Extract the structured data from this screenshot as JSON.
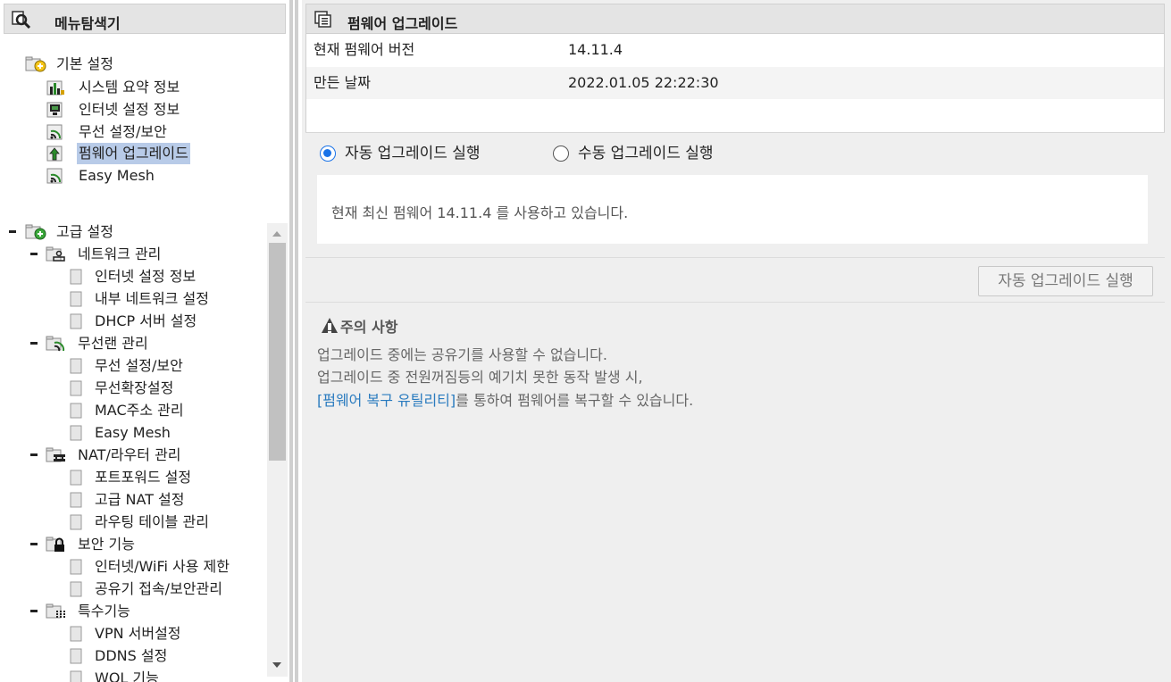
{
  "left_panel": {
    "title": "메뉴탐색기",
    "basic": {
      "label": "기본 설정",
      "items": [
        {
          "label": "시스템 요약 정보",
          "icon": "chart-icon"
        },
        {
          "label": "인터넷 설정 정보",
          "icon": "monitor-icon"
        },
        {
          "label": "무선 설정/보안",
          "icon": "wireless-icon"
        },
        {
          "label": "펌웨어 업그레이드",
          "icon": "upgrade-icon",
          "selected": true
        },
        {
          "label": "Easy Mesh",
          "icon": "wireless-icon"
        }
      ]
    },
    "advanced": {
      "label": "고급 설정",
      "groups": [
        {
          "label": "네트워크 관리",
          "icon": "network-icon",
          "items": [
            "인터넷 설정 정보",
            "내부 네트워크 설정",
            "DHCP 서버 설정"
          ]
        },
        {
          "label": "무선랜 관리",
          "icon": "wireless-icon",
          "items": [
            "무선 설정/보안",
            "무선확장설정",
            "MAC주소 관리",
            "Easy Mesh"
          ]
        },
        {
          "label": "NAT/라우터 관리",
          "icon": "router-icon",
          "items": [
            "포트포워드 설정",
            "고급 NAT 설정",
            "라우팅 테이블 관리"
          ]
        },
        {
          "label": "보안 기능",
          "icon": "lock-icon",
          "items": [
            "인터넷/WiFi 사용 제한",
            "공유기 접속/보안관리"
          ]
        },
        {
          "label": "특수기능",
          "icon": "grid-icon",
          "items": [
            "VPN 서버설정",
            "DDNS 설정",
            "WOL 기능"
          ]
        }
      ]
    }
  },
  "right_panel": {
    "title": "펌웨어 업그레이드",
    "info": [
      {
        "key": "현재 펌웨어 버전",
        "value": "14.11.4"
      },
      {
        "key": "만든 날짜",
        "value": "2022.01.05 22:22:30"
      }
    ],
    "modes": {
      "auto": "자동 업그레이드 실행",
      "manual": "수동 업그레이드 실행",
      "selected": "auto"
    },
    "status_text": "현재 최신 펌웨어 14.11.4 를 사용하고 있습니다.",
    "run_button": "자동 업그레이드 실행",
    "notice": {
      "title": "주의 사항",
      "line1": "업그레이드 중에는 공유기를 사용할 수 없습니다.",
      "line2": "업그레이드 중 전원꺼짐등의 예기치 못한 동작 발생 시,",
      "link": "[펌웨어 복구 유틸리티]",
      "line3_rest": "를 통하여 펌웨어를 복구할 수 있습니다."
    }
  },
  "colors": {
    "selected_bg": "#b8cbe8",
    "link": "#2a7bbf",
    "radio_on": "#1a73e8",
    "panel_bg": "#efefef"
  }
}
